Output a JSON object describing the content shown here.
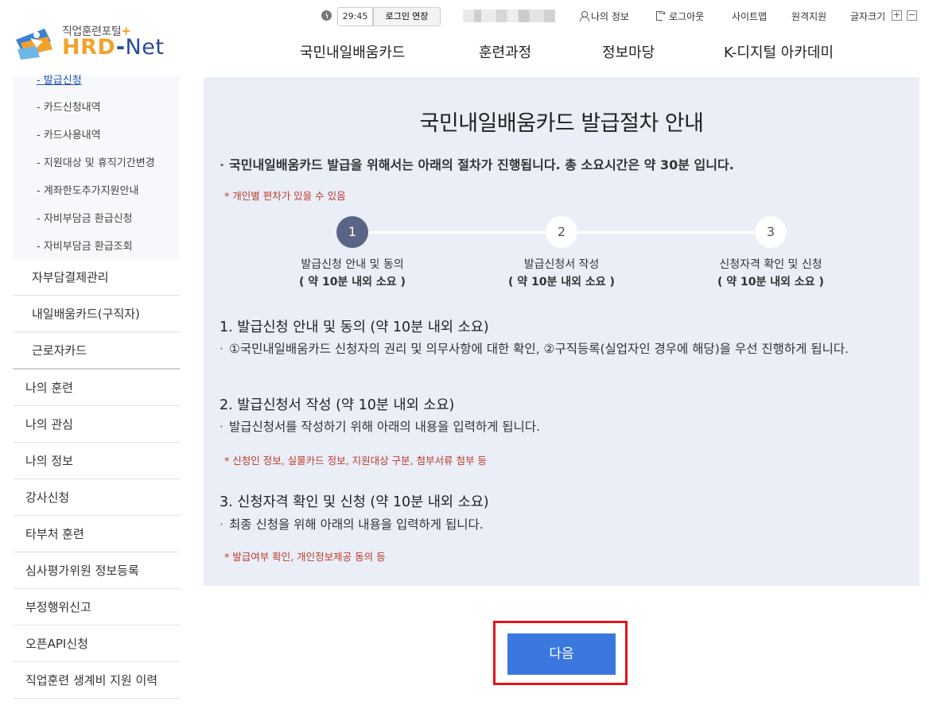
{
  "logo": {
    "sub": "직업훈련포털",
    "plus": "+",
    "hrd": "HRD",
    "dash": "-",
    "net": "Net"
  },
  "util": {
    "timer": "29:45",
    "extend_label": "로그인 연장",
    "my_info": "나의 정보",
    "logout": "로그아웃",
    "sitemap": "사이트맵",
    "remote_support": "원격지원",
    "font_size": "글자크기",
    "font_plus": "+",
    "font_minus": "−"
  },
  "gnb": [
    "국민내일배움카드",
    "훈련과정",
    "정보마당",
    "K-디지털 아카데미"
  ],
  "sidebar": {
    "sub_items": [
      "- 발급신청",
      "- 카드신청내역",
      "- 카드사용내역",
      "- 지원대상 및 휴직기간변경",
      "- 계좌한도추가지원안내",
      "- 자비부담금 환급신청",
      "- 자비부담금 환급조회"
    ],
    "level2": [
      "자부담결제관리",
      "내일배움카드(구직자)",
      "근로자카드"
    ],
    "level1": [
      "나의 훈련",
      "나의 관심",
      "나의 정보",
      "강사신청",
      "타부처 훈련",
      "심사평가위원 정보등록",
      "부정행위신고",
      "오픈API신청",
      "직업훈련 생계비 지원 이력"
    ]
  },
  "main": {
    "title": "국민내일배움카드 발급절차 안내",
    "intro": "국민내일배움카드 발급을 위해서는 아래의 절차가 진행됩니다. 총 소요시간은 약 30분 입니다.",
    "intro_note": "* 개인별 편차가 있을 수 있음",
    "steps": [
      {
        "num": "1",
        "label": "발급신청 안내 및 동의",
        "time": "( 약 10분 내외 소요 )"
      },
      {
        "num": "2",
        "label": "발급신청서 작성",
        "time": "( 약 10분 내외 소요 )"
      },
      {
        "num": "3",
        "label": "신청자격 확인 및 신청",
        "time": "( 약 10분 내외 소요 )"
      }
    ],
    "sections": [
      {
        "title": "1. 발급신청 안내 및 동의 (약 10분 내외 소요)",
        "desc": "①국민내일배움카드 신청자의 권리 및 의무사항에 대한 확인, ②구직등록(실업자인 경우에 해당)을 우선 진행하게 됩니다.",
        "note": ""
      },
      {
        "title": "2. 발급신청서 작성 (약 10분 내외 소요)",
        "desc": "발급신청서를 작성하기 위해 아래의 내용을 입력하게 됩니다.",
        "note": "* 신청인 정보, 실물카드 정보, 지원대상 구분, 첨부서류 첨부 등"
      },
      {
        "title": "3. 신청자격 확인 및 신청 (약 10분 내외 소요)",
        "desc": "최종 신청을 위해 아래의 내용을 입력하게 됩니다.",
        "note": "* 발급여부 확인, 개인정보제공 동의 등"
      }
    ],
    "next_label": "다음"
  },
  "colors": {
    "brand_orange": "#f1a22d",
    "brand_navy": "#2a4a9a",
    "panel_bg": "#e9eef7",
    "active_step": "#5a6486",
    "note_red": "#c0392b",
    "next_button": "#3a78e0",
    "highlight_box": "#e3151b"
  }
}
